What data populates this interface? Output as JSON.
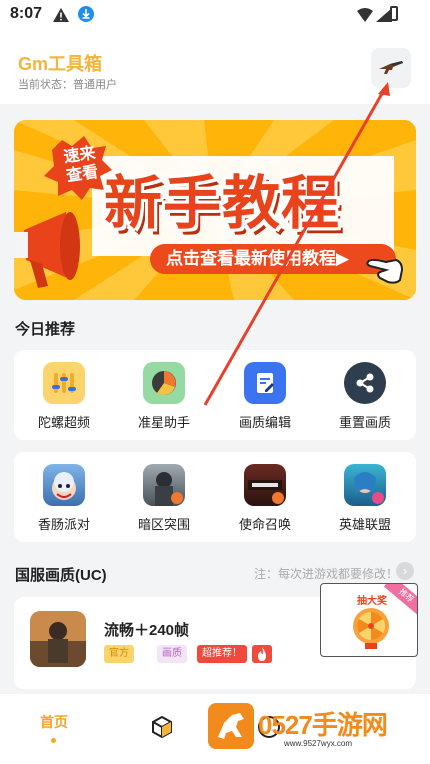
{
  "status_bar": {
    "time": "8:07"
  },
  "header": {
    "title": "Gm工具箱",
    "status": "当前状态：普通用户",
    "tool_icon": "rifle-icon"
  },
  "banner": {
    "tag_line1": "速来",
    "tag_line2": "查看",
    "title": "新手教程",
    "cta": "点击查看最新使用教程▶"
  },
  "today": {
    "title": "今日推荐",
    "tools": [
      {
        "label": "陀螺超频",
        "icon": "sliders-icon",
        "color": "#fbd36b"
      },
      {
        "label": "准星助手",
        "icon": "crosshair-pie-icon",
        "color": "#8fd69f"
      },
      {
        "label": "画质编辑",
        "icon": "edit-document-icon",
        "color": "#3b73f0"
      },
      {
        "label": "重置画质",
        "icon": "share-icon",
        "color": "#2f3e4e"
      }
    ],
    "games": [
      {
        "label": "香肠派对",
        "icon": "sausage-party-icon"
      },
      {
        "label": "暗区突围",
        "icon": "arena-breakout-icon"
      },
      {
        "label": "使命召唤",
        "icon": "call-of-duty-icon"
      },
      {
        "label": "英雄联盟",
        "icon": "league-of-legends-icon"
      }
    ]
  },
  "section2": {
    "title": "国服画质(UC)",
    "note": "注：每次进游戏都要修改！",
    "item": {
      "title": "流畅＋240帧",
      "badges": [
        "官方",
        "画质",
        "超推荐！"
      ],
      "fire_icon": "fire-icon"
    }
  },
  "float_widget": {
    "title": "抽大奖",
    "corner": "推荐"
  },
  "bottom_nav": {
    "home": "首页"
  },
  "watermark": {
    "text": "0527手游网",
    "url": "www.9527wyx.com"
  }
}
